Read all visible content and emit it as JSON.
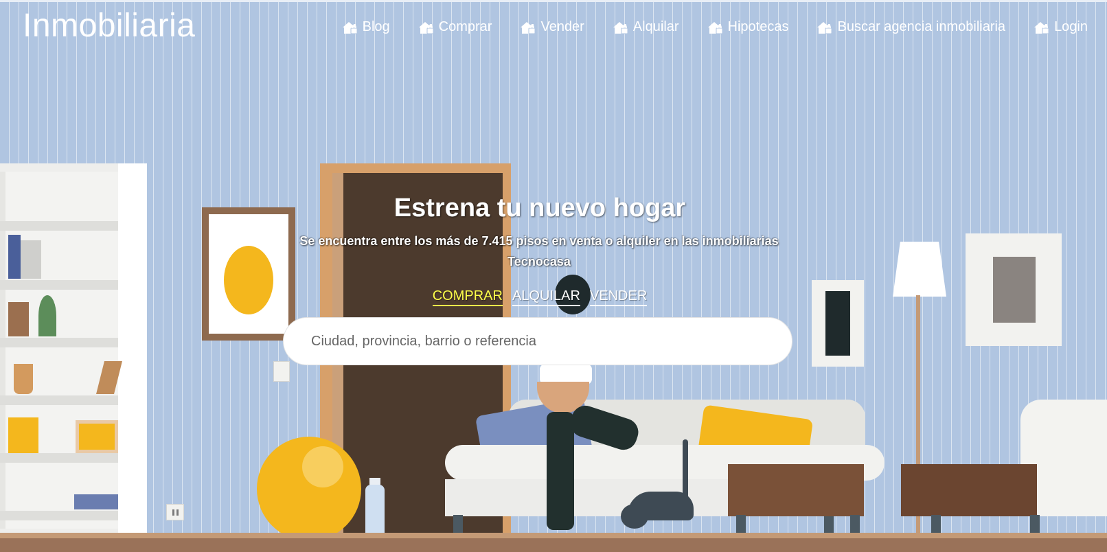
{
  "header": {
    "logo": "Inmobiliaria",
    "nav": [
      {
        "label": "Blog",
        "icon": "home-lock-icon"
      },
      {
        "label": "Comprar",
        "icon": "home-lock-icon"
      },
      {
        "label": "Vender",
        "icon": "home-lock-icon"
      },
      {
        "label": "Alquilar",
        "icon": "home-lock-icon"
      },
      {
        "label": "Hipotecas",
        "icon": "home-lock-icon"
      },
      {
        "label": "Buscar agencia inmobiliaria",
        "icon": "home-lock-icon"
      },
      {
        "label": "Login",
        "icon": "home-lock-icon"
      }
    ]
  },
  "hero": {
    "title": "Estrena tu nuevo hogar",
    "subtitle": "Se encuentra entre los más de 7.415 pisos en venta o alquiler en las inmobiliarias Tecnocasa",
    "tabs": [
      {
        "label": "COMPRAR",
        "active": true
      },
      {
        "label": "ALQUILAR",
        "active": false
      },
      {
        "label": "VENDER",
        "active": false
      }
    ],
    "search": {
      "placeholder": "Ciudad, provincia, barrio o referencia",
      "value": ""
    }
  },
  "colors": {
    "wall": "#b0c5e1",
    "active_tab": "#ffff4a",
    "accent_yellow": "#f4b71d",
    "text_light": "#ffffff"
  }
}
